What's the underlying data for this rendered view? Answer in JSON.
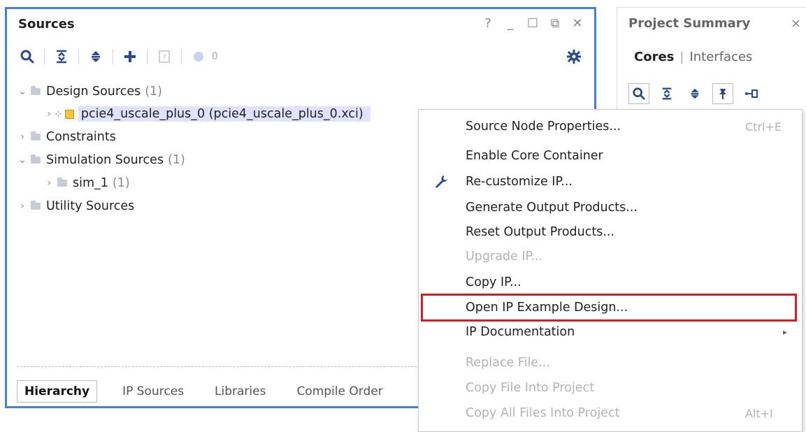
{
  "sources": {
    "title": "Sources",
    "window_controls": [
      "?",
      "_",
      "☐",
      "⧉",
      "✕"
    ],
    "toolbar": {
      "count": "0"
    },
    "tree": {
      "design_sources": {
        "label": "Design Sources",
        "count": "(1)"
      },
      "ip_item": {
        "label": "pcie4_uscale_plus_0 (pcie4_uscale_plus_0.xci)"
      },
      "constraints": {
        "label": "Constraints"
      },
      "simulation_sources": {
        "label": "Simulation Sources",
        "count": "(1)"
      },
      "sim_1": {
        "label": "sim_1",
        "count": "(1)"
      },
      "utility_sources": {
        "label": "Utility Sources"
      }
    },
    "tabs": [
      "Hierarchy",
      "IP Sources",
      "Libraries",
      "Compile Order"
    ]
  },
  "project_summary": {
    "title": "Project Summary",
    "close": "×",
    "cores_label": "Cores",
    "separator": "|",
    "interfaces_label": "Interfaces"
  },
  "context_menu": {
    "items": [
      {
        "label": "Source Node Properties...",
        "shortcut": "Ctrl+E",
        "enabled": true
      },
      {
        "label": "Enable Core Container",
        "enabled": true
      },
      {
        "label": "Re-customize IP...",
        "enabled": true,
        "icon": "wrench-icon"
      },
      {
        "label": "Generate Output Products...",
        "enabled": true
      },
      {
        "label": "Reset Output Products...",
        "enabled": true
      },
      {
        "label": "Upgrade IP...",
        "enabled": false
      },
      {
        "label": "Copy IP...",
        "enabled": true
      },
      {
        "label": "Open IP Example Design...",
        "enabled": true,
        "highlighted": true
      },
      {
        "label": "IP Documentation",
        "enabled": true,
        "submenu": true
      },
      {
        "label": "Replace File...",
        "enabled": false
      },
      {
        "label": "Copy File Into Project",
        "enabled": false
      },
      {
        "label": "Copy All Files Into Project",
        "shortcut": "Alt+I",
        "enabled": false
      }
    ]
  },
  "colors": {
    "panel_border": "#4a7fd4",
    "highlight_box": "#d21e2a",
    "selected_row": "#dfe3ff",
    "accent_icon": "#2b4a8a"
  }
}
